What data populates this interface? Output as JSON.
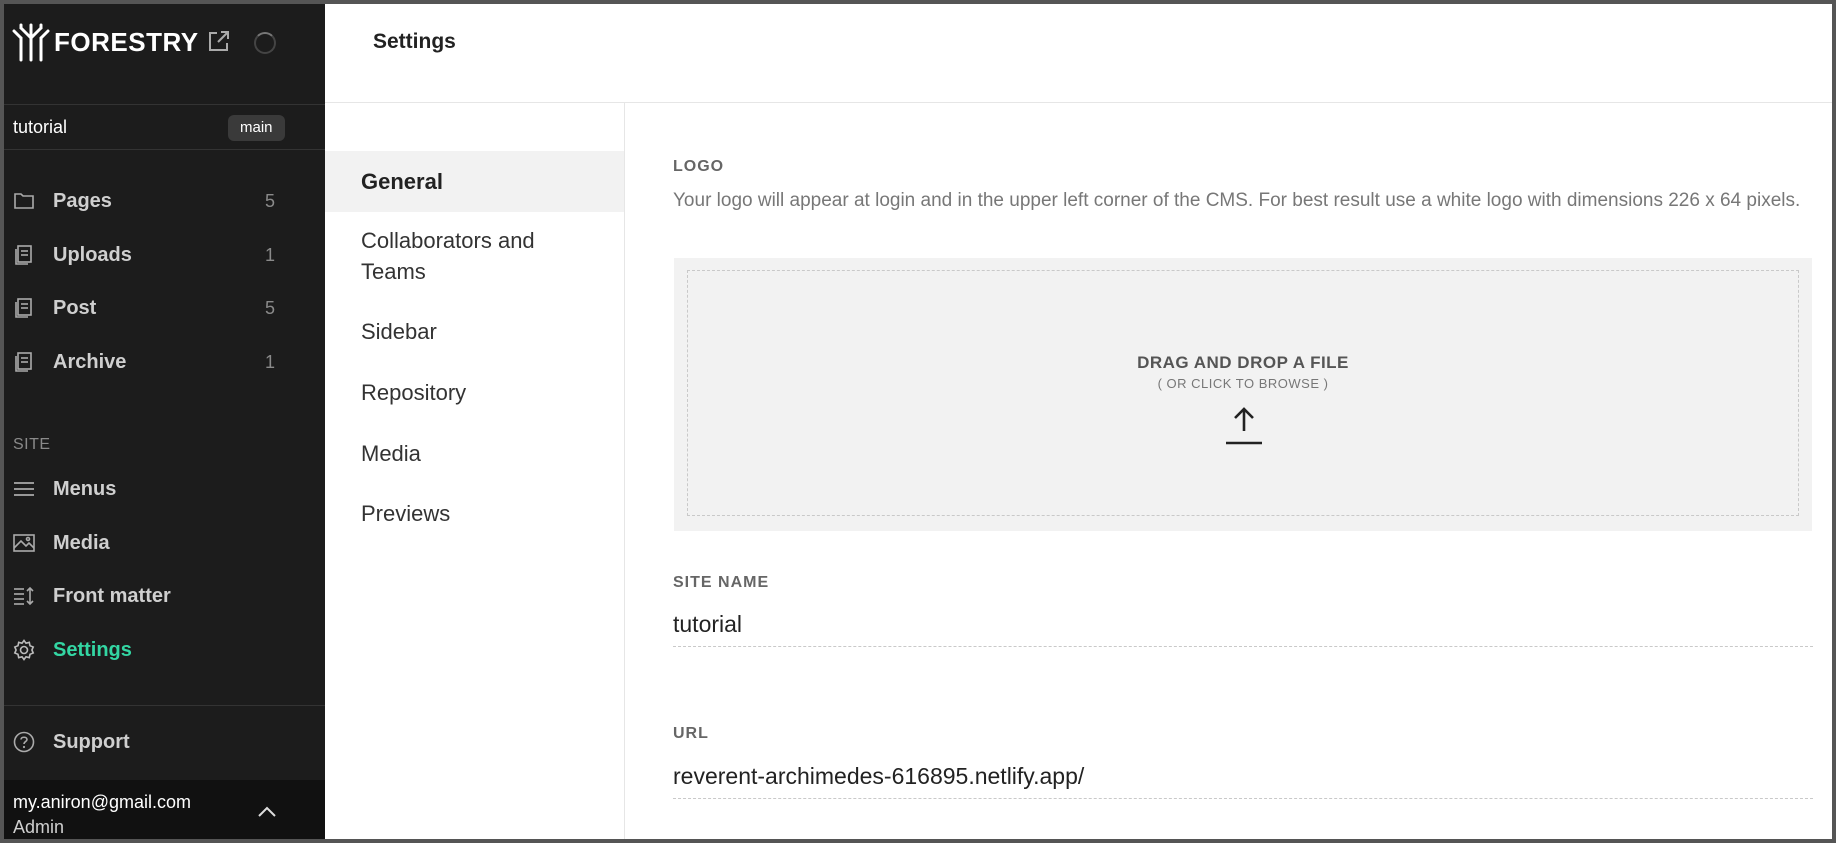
{
  "brand": {
    "name": "FORESTRY"
  },
  "site": {
    "name": "tutorial",
    "branch": "main"
  },
  "sidebar": {
    "content_items": [
      {
        "label": "Pages",
        "count": "5",
        "icon": "folder-icon"
      },
      {
        "label": "Uploads",
        "count": "1",
        "icon": "documents-icon"
      },
      {
        "label": "Post",
        "count": "5",
        "icon": "documents-icon"
      },
      {
        "label": "Archive",
        "count": "1",
        "icon": "documents-icon"
      }
    ],
    "section_label": "SITE",
    "site_items": [
      {
        "label": "Menus",
        "icon": "menu-icon"
      },
      {
        "label": "Media",
        "icon": "image-icon"
      },
      {
        "label": "Front matter",
        "icon": "front-matter-icon"
      },
      {
        "label": "Settings",
        "icon": "gear-icon"
      }
    ],
    "support_label": "Support"
  },
  "user": {
    "email": "my.aniron@gmail.com",
    "role": "Admin"
  },
  "header": {
    "title": "Settings"
  },
  "settings_nav": [
    {
      "label": "General"
    },
    {
      "label": "Collaborators and Teams"
    },
    {
      "label": "Sidebar"
    },
    {
      "label": "Repository"
    },
    {
      "label": "Media"
    },
    {
      "label": "Previews"
    }
  ],
  "general": {
    "logo_label": "LOGO",
    "logo_help": "Your logo will appear at login and in the upper left corner of the CMS. For best result use a white logo with dimensions 226 x 64 pixels.",
    "dropzone_title": "DRAG AND DROP A FILE",
    "dropzone_sub": "( OR CLICK TO BROWSE )",
    "site_name_label": "SITE NAME",
    "site_name_value": "tutorial",
    "url_label": "URL",
    "url_value": "reverent-archimedes-616895.netlify.app/"
  },
  "colors": {
    "accent": "#33d6a3",
    "sidebar_bg": "#1c1c1c"
  }
}
